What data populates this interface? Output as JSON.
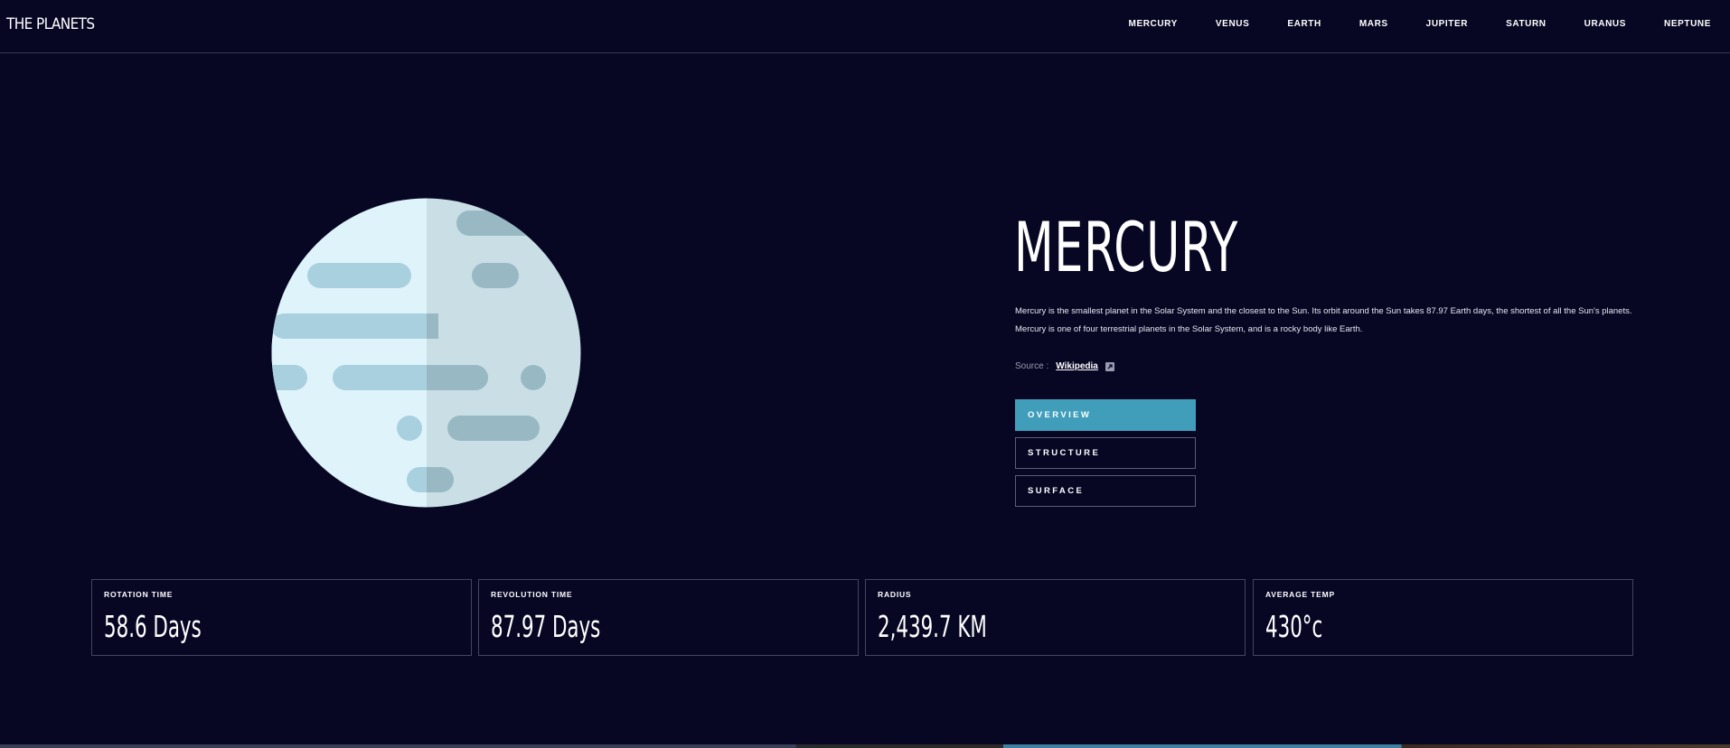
{
  "header": {
    "logo": "THE PLANETS",
    "nav": [
      "MERCURY",
      "VENUS",
      "EARTH",
      "MARS",
      "JUPITER",
      "SATURN",
      "URANUS",
      "NEPTUNE"
    ]
  },
  "planet": {
    "name": "MERCURY",
    "description_line1": "Mercury is the smallest planet in the Solar System and the closest to the Sun. Its orbit around the Sun takes 87.97 Earth days, the shortest of all the Sun's planets.",
    "description_line2": "Mercury is one of four terrestrial planets in the Solar System, and is a rocky body like Earth.",
    "source_label": "Source :",
    "source_link": "Wikipedia",
    "image_icon": "mercury-planet-illustration"
  },
  "tabs": [
    {
      "label": "OVERVIEW",
      "active": true
    },
    {
      "label": "STRUCTURE",
      "active": false
    },
    {
      "label": "SURFACE",
      "active": false
    }
  ],
  "stats": [
    {
      "label": "ROTATION TIME",
      "value": "58.6 Days"
    },
    {
      "label": "REVOLUTION TIME",
      "value": "87.97 Days"
    },
    {
      "label": "RADIUS",
      "value": "2,439.7 KM"
    },
    {
      "label": "AVERAGE TEMP",
      "value": "430°c"
    }
  ],
  "colors": {
    "background": "#070724",
    "accent": "#419ebb",
    "border": "#38384f"
  }
}
